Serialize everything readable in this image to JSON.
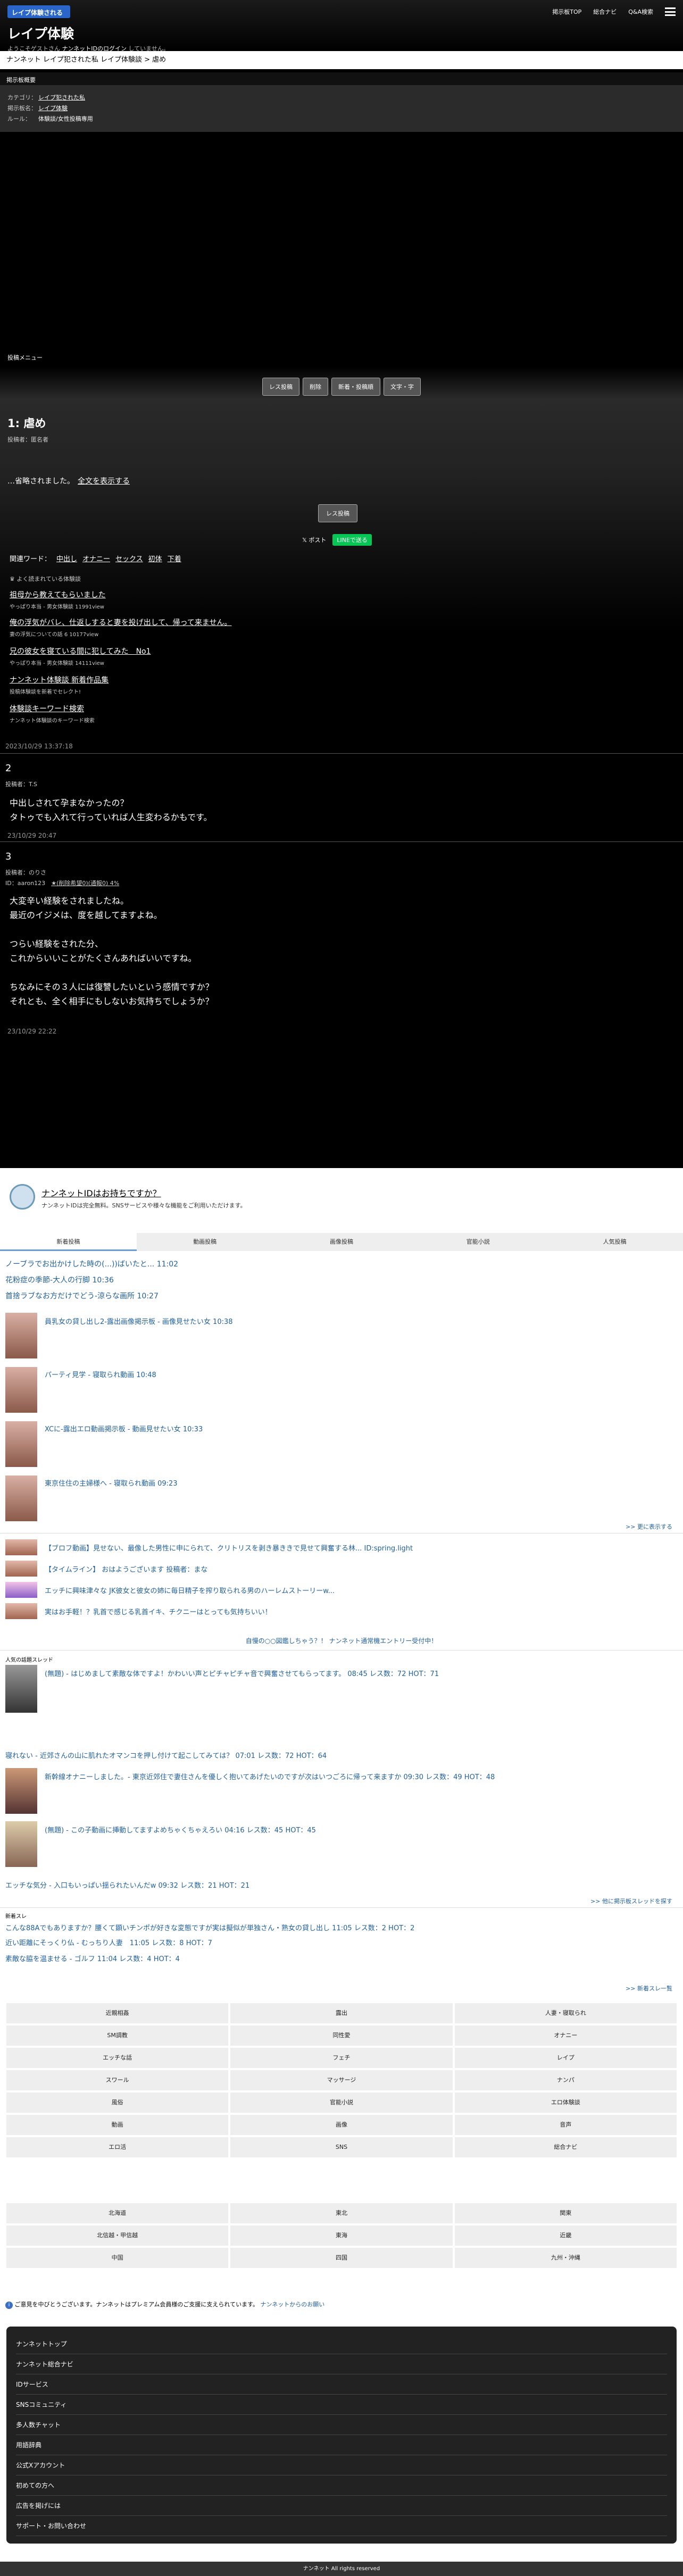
{
  "header": {
    "logo_text": "レイプ体験される",
    "title": "レイプ体験",
    "sub_prefix": "ようこそゲストさん",
    "sub_link": "ナンネットIDのログイン",
    "sub_suffix": "していません。",
    "nav": [
      "掲示板TOP",
      "総合ナビ",
      "Q&A検索"
    ]
  },
  "breadcrumb": "ナンネット レイプ犯された私 レイプ体験談 > 虐め",
  "region": "掲示板概要",
  "categories": [
    {
      "label": "カテゴリ：",
      "value": "レイプ犯された私"
    },
    {
      "label": "掲示板名：",
      "value": "レイプ体験"
    },
    {
      "label": "ルール：",
      "value": "体験談/女性投稿専用"
    }
  ],
  "menu_label": "投稿メニュー",
  "action_buttons": [
    "レス投稿",
    "削除",
    "新着・投稿順",
    "文字・字"
  ],
  "post": {
    "title": "1: 虐め",
    "meta": "投稿者：匿名者",
    "omitted": "…省略されました。",
    "show_all": "全文を表示する",
    "res_button": "レス投稿",
    "post_label": "𝕏 ポスト",
    "line_label": "LINEで送る",
    "keyword_label": "関連ワード：",
    "keywords": [
      "中出し",
      "オナニー",
      "セックス",
      "初体",
      "下着"
    ],
    "popular_label": "よく読まれている体験談",
    "recommended": [
      {
        "title": "祖母から教えてもらいました",
        "desc": "やっぱり本当 - 男女体験談 11991view"
      },
      {
        "title": "俺の浮気がバレ、仕返しすると妻を投げ出して、帰って来ません。",
        "desc": "妻の浮気についての話 6 10177view"
      },
      {
        "title": "兄の彼女を寝ている間に犯してみた　No1",
        "desc": "やっぱり本当 - 男女体験談 14111view"
      },
      {
        "title": "ナンネット体験談 新着作品集",
        "desc": "投稿体験談を新着でセレクト!"
      },
      {
        "title": "体験談キーワード検索",
        "desc": "ナンネット体験談のキーワード検索"
      }
    ],
    "date": "2023/10/29 13:37:18"
  },
  "replies": [
    {
      "num": "2",
      "meta": "投稿者：T.S",
      "body": [
        "中出しされて孕まなかったの？",
        "タトゥでも入れて行っていれば人生変わるかもです。"
      ],
      "date": "23/10/29 20:47"
    },
    {
      "num": "3",
      "meta": "投稿者：のりさ",
      "meta2": "ID：aaron123",
      "meta3": "★(削除希望0)(通報0) 4%",
      "body": [
        "大変辛い経験をされましたね。",
        "",
        "最近のイジメは、度を越してますよね。",
        "",
        "つらい経験をされた分、",
        "これからいいことがたくさんあればいいですね。",
        "",
        "ちなみにその３人には復讐したいという感情ですか？",
        "それとも、全く相手にもしないお気持ちでしょうか？"
      ],
      "date": "23/10/29 22:22"
    }
  ],
  "id_box": {
    "title": "ナンネットIDはお持ちですか？",
    "desc": "ナンネットIDは完全無料。SNSサービスや様々な機能をご利用いただけます。"
  },
  "tabs": [
    "新着投稿",
    "動画投稿",
    "画像投稿",
    "官能小説",
    "人気投稿"
  ],
  "text_links": [
    "ノーブラでお出かけした時の(...))ばいたと...  11:02",
    "花粉症の季節-大人の行脚  10:36",
    "首捨ラブなお方だけでどう-涼らな画所  10:27"
  ],
  "thumb_items": [
    "員乳女の貸し出し2-露出画像掲示板 - 画像見せたい女  10:38",
    "パーティ見学 - 寝取られ動画  10:48",
    "XCに-露出エロ動画掲示板 - 動画見せたい女  10:33",
    "東京住住の主婦様へ - 寝取られ動画  09:23"
  ],
  "more1": ">> 更に表示する",
  "small_items": [
    "【ブロフ動画】見せない、最像した男性に申にられて、クリトリスを剥き暴ききで見せて興奮する林... ID:spring.light",
    "【タイムライン】 おはようございます  投稿者：まな",
    "エッチに興味津々な JK彼女と彼女の姉に毎日精子を搾り取られる男のハーレムストーリーw...",
    "実はお手軽！？乳首で感じる乳首イキ、チクニーはとっても気持ちいい！"
  ],
  "promo": "自慢の○○図鑑しちゃう？！ ナンネット通常機エントリー受付中！",
  "hot_label": "人気の話題スレッド",
  "hot_threads": [
    {
      "title": "(無題) - はじめまして素敵な体ですよ！かわいい声とピチャピチャ音で興奮させてもらってます。  08:45 レス数：72 HOT：71",
      "hot": "HOT：71"
    },
    {
      "title": "寝れない - 近郊さんの山に肌れたオマンコを押し付けて起こしてみては？ 07:01 レス数：72 HOT：64",
      "hot": "HOT：64"
    },
    {
      "title": "新幹線オナニーしました。- 東京近郊住で妻住さんを優しく抱いてあげたいのですが次はいつごろに帰って来ますか 09:30 レス数：49 HOT：48",
      "hot": "HOT：48"
    },
    {
      "title": "(無題) - この子動画に挿動してますよめちゃくちゃえろい 04:16 レス数：45 HOT：45",
      "hot": "HOT：45"
    },
    {
      "title": "エッチな気分 - 入口もいっぱい揺られたいんだw  09:32 レス数：21 HOT：21",
      "hot": "HOT：21"
    }
  ],
  "more2": ">> 他に掲示板スレッドを探す",
  "new_label": "新着スレ",
  "new_threads": [
    "こんな88Aでもありますか？腰くて顕いチンポが好きな変態ですが実は擬似が単独さん・熟女の貸し出し 11:05 レス数：2 HOT：2",
    "近い距離にそっくり仏 - むっちり人妻　11:05 レス数：8 HOT：7",
    "素敵な脇を温ませる - ゴルフ 11:04 レス数：4 HOT：4"
  ],
  "more3": ">> 新着スレ一覧",
  "grid1": [
    "近親相姦",
    "露出",
    "人妻・寝取られ",
    "SM調教",
    "同性愛",
    "オナニー",
    "エッチな話",
    "フェチ",
    "レイプ",
    "スワール",
    "マッサージ",
    "ナンパ",
    "風俗",
    "官能小説",
    "エロ体験談",
    "動画",
    "画像",
    "音声",
    "エロ活",
    "SNS",
    "総合ナビ"
  ],
  "grid2": [
    "北海道",
    "東北",
    "関東",
    "北信越・甲信越",
    "東海",
    "近畿",
    "中国",
    "四国",
    "九州・沖縄"
  ],
  "notice": "ご意見を中びとうございます。ナンネットはプレミアム会員様のご支援に支えられています。",
  "notice_link": "ナンネットからのお願い",
  "footer_links": [
    "ナンネットトップ",
    "ナンネット総合ナビ",
    "IDサービス",
    "SNSコミュニティ",
    "多人数チャット",
    "用語辞典",
    "公式Xアカウント",
    "初めての方へ",
    "広告を掲げには",
    "サポート・お問い合わせ"
  ],
  "copyright": "ナンネット All rights reserved"
}
